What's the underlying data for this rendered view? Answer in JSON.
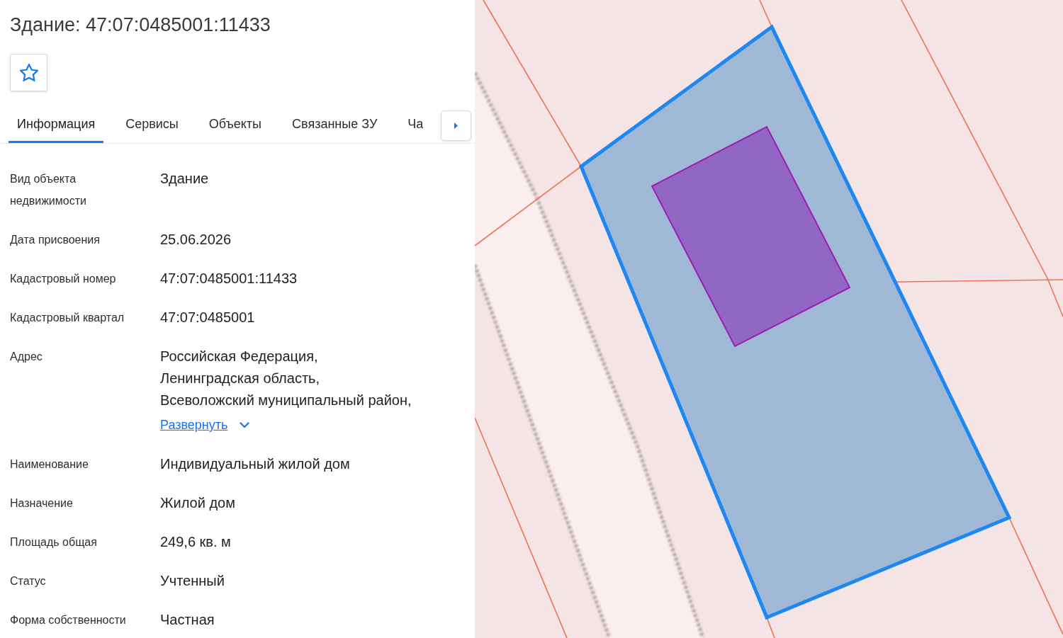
{
  "header": {
    "title": "Здание: 47:07:0485001:11433",
    "favorite": false
  },
  "tabs": [
    {
      "label": "Информация",
      "selected": true
    },
    {
      "label": "Сервисы",
      "selected": false
    },
    {
      "label": "Объекты",
      "selected": false
    },
    {
      "label": "Связанные ЗУ",
      "selected": false
    },
    {
      "label": "Ча",
      "selected": false
    }
  ],
  "fields": [
    {
      "kind": "text",
      "label": "Вид объекта недвижимости",
      "value": "Здание"
    },
    {
      "kind": "text",
      "label": "Дата присвоения",
      "value": "25.06.2026"
    },
    {
      "kind": "text",
      "label": "Кадастровый номер",
      "value": "47:07:0485001:11433"
    },
    {
      "kind": "text",
      "label": "Кадастровый квартал",
      "value": "47:07:0485001"
    },
    {
      "kind": "address",
      "label": "Адрес",
      "value_lines": [
        "Российская Федерация,",
        "Ленинградская область,",
        "Всеволожский муниципальный район,"
      ],
      "expand_link": "Развернуть"
    },
    {
      "kind": "text",
      "label": "Наименование",
      "value": "Индивидуальный жилой дом"
    },
    {
      "kind": "text",
      "label": "Назначение",
      "value": "Жилой дом"
    },
    {
      "kind": "text",
      "label": "Площадь общая",
      "value": "249,6 кв. м"
    },
    {
      "kind": "text",
      "label": "Статус",
      "value": "Учтенный"
    },
    {
      "kind": "text",
      "label": "Форма собственности",
      "value": "Частная"
    }
  ]
}
